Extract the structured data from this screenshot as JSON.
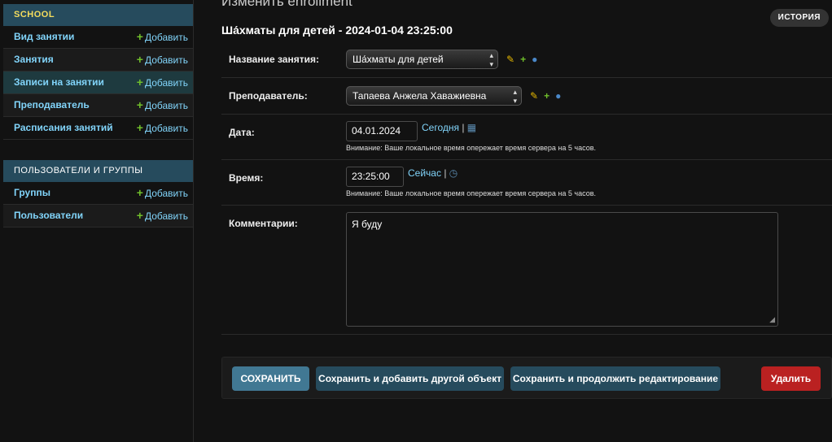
{
  "sidebar": {
    "school": {
      "caption": "SCHOOL",
      "items": [
        {
          "label": "Вид занятии",
          "add": "Добавить"
        },
        {
          "label": "Занятия",
          "add": "Добавить"
        },
        {
          "label": "Записи на занятии",
          "add": "Добавить"
        },
        {
          "label": "Преподаватель",
          "add": "Добавить"
        },
        {
          "label": "Расписания занятий",
          "add": "Добавить"
        }
      ]
    },
    "users": {
      "caption": "ПОЛЬЗОВАТЕЛИ И ГРУППЫ",
      "items": [
        {
          "label": "Группы",
          "add": "Добавить"
        },
        {
          "label": "Пользователи",
          "add": "Добавить"
        }
      ]
    }
  },
  "main": {
    "page_title": "Изменить enrollment",
    "history": "ИСТОРИЯ",
    "object_title": "Ша́хматы для детей - 2024-01-04 23:25:00",
    "fields": {
      "lesson": {
        "label": "Название занятия:",
        "value": "Ша́хматы для детей"
      },
      "teacher": {
        "label": "Преподаватель:",
        "value": "Тапаева Анжела Хавaжиевна"
      },
      "date": {
        "label": "Дата:",
        "value": "04.01.2024",
        "shortcut": "Сегодня",
        "help": "Внимание: Ваше локальное время опережает время сервера на 5 часов."
      },
      "time": {
        "label": "Время:",
        "value": "23:25:00",
        "shortcut": "Сейчас",
        "help": "Внимание: Ваше локальное время опережает время сервера на 5 часов."
      },
      "comment": {
        "label": "Комментарии:",
        "value": "Я буду"
      }
    },
    "buttons": {
      "save": "СОХРАНИТЬ",
      "save_add": "Сохранить и добавить другой объект",
      "save_continue": "Сохранить и продолжить редактирование",
      "delete": "Удалить"
    }
  },
  "colors": {
    "caption_bg": "#264b5d",
    "link": "#81d4fa",
    "add_plus": "#70bf2b",
    "save_btn": "#417893",
    "delete_btn": "#ba2121"
  }
}
